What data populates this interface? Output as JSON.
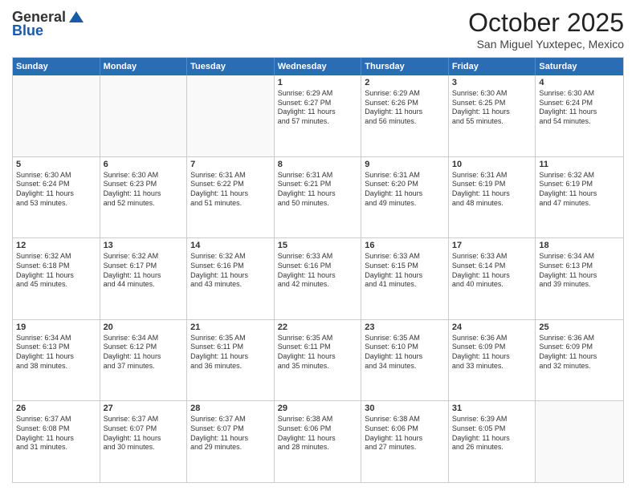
{
  "header": {
    "logo_general": "General",
    "logo_blue": "Blue",
    "month_title": "October 2025",
    "location": "San Miguel Yuxtepec, Mexico"
  },
  "weekdays": [
    "Sunday",
    "Monday",
    "Tuesday",
    "Wednesday",
    "Thursday",
    "Friday",
    "Saturday"
  ],
  "rows": [
    [
      {
        "day": "",
        "lines": []
      },
      {
        "day": "",
        "lines": []
      },
      {
        "day": "",
        "lines": []
      },
      {
        "day": "1",
        "lines": [
          "Sunrise: 6:29 AM",
          "Sunset: 6:27 PM",
          "Daylight: 11 hours",
          "and 57 minutes."
        ]
      },
      {
        "day": "2",
        "lines": [
          "Sunrise: 6:29 AM",
          "Sunset: 6:26 PM",
          "Daylight: 11 hours",
          "and 56 minutes."
        ]
      },
      {
        "day": "3",
        "lines": [
          "Sunrise: 6:30 AM",
          "Sunset: 6:25 PM",
          "Daylight: 11 hours",
          "and 55 minutes."
        ]
      },
      {
        "day": "4",
        "lines": [
          "Sunrise: 6:30 AM",
          "Sunset: 6:24 PM",
          "Daylight: 11 hours",
          "and 54 minutes."
        ]
      }
    ],
    [
      {
        "day": "5",
        "lines": [
          "Sunrise: 6:30 AM",
          "Sunset: 6:24 PM",
          "Daylight: 11 hours",
          "and 53 minutes."
        ]
      },
      {
        "day": "6",
        "lines": [
          "Sunrise: 6:30 AM",
          "Sunset: 6:23 PM",
          "Daylight: 11 hours",
          "and 52 minutes."
        ]
      },
      {
        "day": "7",
        "lines": [
          "Sunrise: 6:31 AM",
          "Sunset: 6:22 PM",
          "Daylight: 11 hours",
          "and 51 minutes."
        ]
      },
      {
        "day": "8",
        "lines": [
          "Sunrise: 6:31 AM",
          "Sunset: 6:21 PM",
          "Daylight: 11 hours",
          "and 50 minutes."
        ]
      },
      {
        "day": "9",
        "lines": [
          "Sunrise: 6:31 AM",
          "Sunset: 6:20 PM",
          "Daylight: 11 hours",
          "and 49 minutes."
        ]
      },
      {
        "day": "10",
        "lines": [
          "Sunrise: 6:31 AM",
          "Sunset: 6:19 PM",
          "Daylight: 11 hours",
          "and 48 minutes."
        ]
      },
      {
        "day": "11",
        "lines": [
          "Sunrise: 6:32 AM",
          "Sunset: 6:19 PM",
          "Daylight: 11 hours",
          "and 47 minutes."
        ]
      }
    ],
    [
      {
        "day": "12",
        "lines": [
          "Sunrise: 6:32 AM",
          "Sunset: 6:18 PM",
          "Daylight: 11 hours",
          "and 45 minutes."
        ]
      },
      {
        "day": "13",
        "lines": [
          "Sunrise: 6:32 AM",
          "Sunset: 6:17 PM",
          "Daylight: 11 hours",
          "and 44 minutes."
        ]
      },
      {
        "day": "14",
        "lines": [
          "Sunrise: 6:32 AM",
          "Sunset: 6:16 PM",
          "Daylight: 11 hours",
          "and 43 minutes."
        ]
      },
      {
        "day": "15",
        "lines": [
          "Sunrise: 6:33 AM",
          "Sunset: 6:16 PM",
          "Daylight: 11 hours",
          "and 42 minutes."
        ]
      },
      {
        "day": "16",
        "lines": [
          "Sunrise: 6:33 AM",
          "Sunset: 6:15 PM",
          "Daylight: 11 hours",
          "and 41 minutes."
        ]
      },
      {
        "day": "17",
        "lines": [
          "Sunrise: 6:33 AM",
          "Sunset: 6:14 PM",
          "Daylight: 11 hours",
          "and 40 minutes."
        ]
      },
      {
        "day": "18",
        "lines": [
          "Sunrise: 6:34 AM",
          "Sunset: 6:13 PM",
          "Daylight: 11 hours",
          "and 39 minutes."
        ]
      }
    ],
    [
      {
        "day": "19",
        "lines": [
          "Sunrise: 6:34 AM",
          "Sunset: 6:13 PM",
          "Daylight: 11 hours",
          "and 38 minutes."
        ]
      },
      {
        "day": "20",
        "lines": [
          "Sunrise: 6:34 AM",
          "Sunset: 6:12 PM",
          "Daylight: 11 hours",
          "and 37 minutes."
        ]
      },
      {
        "day": "21",
        "lines": [
          "Sunrise: 6:35 AM",
          "Sunset: 6:11 PM",
          "Daylight: 11 hours",
          "and 36 minutes."
        ]
      },
      {
        "day": "22",
        "lines": [
          "Sunrise: 6:35 AM",
          "Sunset: 6:11 PM",
          "Daylight: 11 hours",
          "and 35 minutes."
        ]
      },
      {
        "day": "23",
        "lines": [
          "Sunrise: 6:35 AM",
          "Sunset: 6:10 PM",
          "Daylight: 11 hours",
          "and 34 minutes."
        ]
      },
      {
        "day": "24",
        "lines": [
          "Sunrise: 6:36 AM",
          "Sunset: 6:09 PM",
          "Daylight: 11 hours",
          "and 33 minutes."
        ]
      },
      {
        "day": "25",
        "lines": [
          "Sunrise: 6:36 AM",
          "Sunset: 6:09 PM",
          "Daylight: 11 hours",
          "and 32 minutes."
        ]
      }
    ],
    [
      {
        "day": "26",
        "lines": [
          "Sunrise: 6:37 AM",
          "Sunset: 6:08 PM",
          "Daylight: 11 hours",
          "and 31 minutes."
        ]
      },
      {
        "day": "27",
        "lines": [
          "Sunrise: 6:37 AM",
          "Sunset: 6:07 PM",
          "Daylight: 11 hours",
          "and 30 minutes."
        ]
      },
      {
        "day": "28",
        "lines": [
          "Sunrise: 6:37 AM",
          "Sunset: 6:07 PM",
          "Daylight: 11 hours",
          "and 29 minutes."
        ]
      },
      {
        "day": "29",
        "lines": [
          "Sunrise: 6:38 AM",
          "Sunset: 6:06 PM",
          "Daylight: 11 hours",
          "and 28 minutes."
        ]
      },
      {
        "day": "30",
        "lines": [
          "Sunrise: 6:38 AM",
          "Sunset: 6:06 PM",
          "Daylight: 11 hours",
          "and 27 minutes."
        ]
      },
      {
        "day": "31",
        "lines": [
          "Sunrise: 6:39 AM",
          "Sunset: 6:05 PM",
          "Daylight: 11 hours",
          "and 26 minutes."
        ]
      },
      {
        "day": "",
        "lines": []
      }
    ]
  ]
}
